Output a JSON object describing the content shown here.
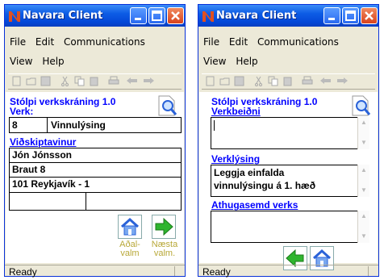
{
  "app": {
    "title": "Navara Client"
  },
  "menu": {
    "file": "File",
    "edit": "Edit",
    "communications": "Communications",
    "view": "View",
    "help": "Help"
  },
  "status": "Ready",
  "screen1": {
    "form_title": "Stólpi verkskráning 1.0",
    "verk_label": "Verk:",
    "verk_number": "8",
    "verk_name": "Vinnulýsing",
    "customer_label": "Viðskiptavinur",
    "customer_name": "Jón Jónsson",
    "customer_street": "Braut 8",
    "customer_city": "101 Reykjavík - 1",
    "home_caption": "Aðal-\nvalm",
    "next_caption": "Næsta\nvalm."
  },
  "screen2": {
    "form_title": "Stólpi verkskráning 1.0",
    "request_label": "Verkbeiðni",
    "request_text": "",
    "description_label": "Verklýsing",
    "description_text_line1": "Leggja einfalda",
    "description_text_line2": "vinnulýsingu á 1. hæð",
    "notes_label": "Athugasemd verks",
    "notes_text": ""
  },
  "icons": {
    "app": "navara-logo-icon",
    "search": "search-document-icon",
    "home": "home-icon",
    "next": "arrow-right-icon",
    "back": "arrow-left-icon"
  },
  "colors": {
    "title_bar": "#0447d7",
    "label_blue": "#0000ff",
    "caption": "#b8a838",
    "arrow_green": "#2fb52f"
  }
}
